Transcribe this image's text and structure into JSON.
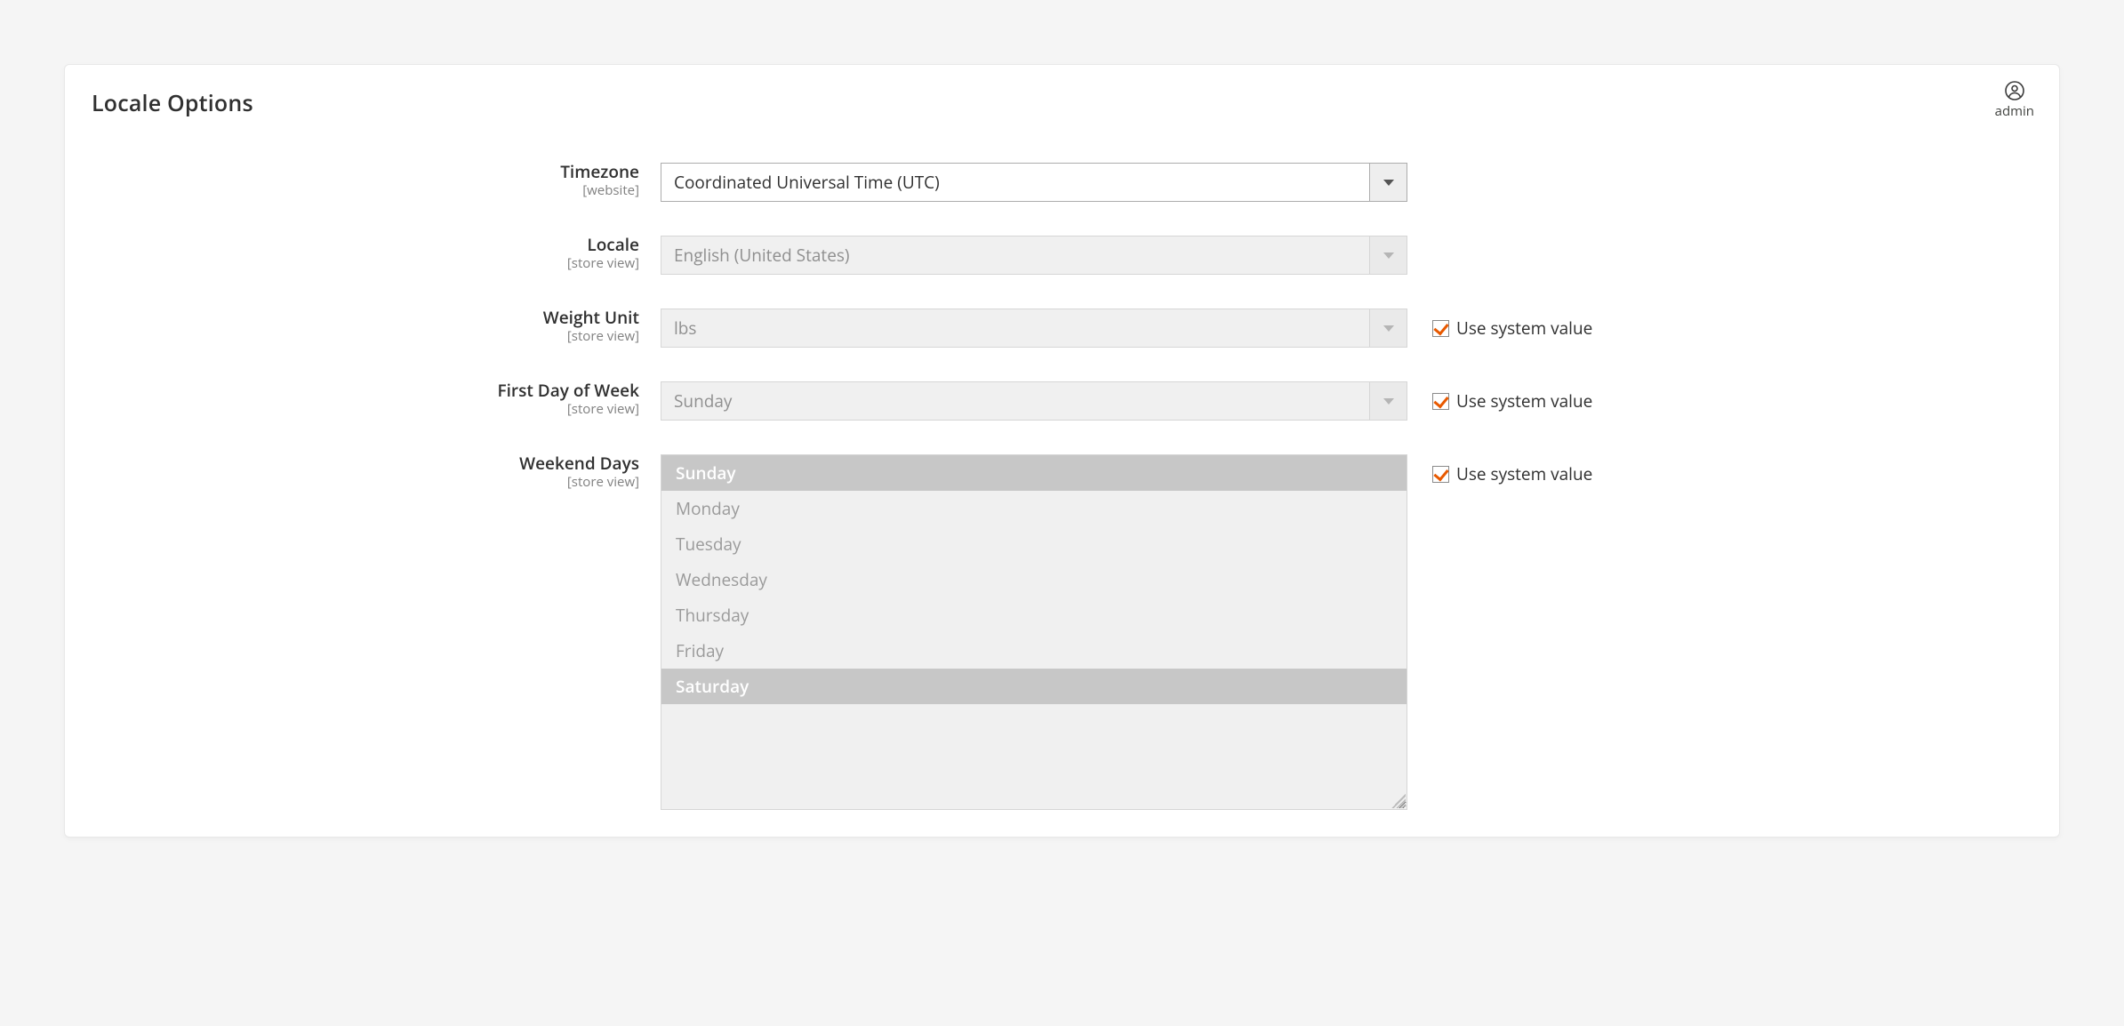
{
  "section": {
    "title": "Locale Options"
  },
  "header": {
    "admin_label": "admin"
  },
  "common": {
    "use_system_value": "Use system value"
  },
  "scopes": {
    "website": "[website]",
    "store_view": "[store view]"
  },
  "fields": {
    "timezone": {
      "label": "Timezone",
      "scope": "[website]",
      "value": "Coordinated Universal Time (UTC)"
    },
    "locale": {
      "label": "Locale",
      "scope": "[store view]",
      "value": "English (United States)"
    },
    "weight_unit": {
      "label": "Weight Unit",
      "scope": "[store view]",
      "value": "lbs",
      "use_system": true
    },
    "first_day_of_week": {
      "label": "First Day of Week",
      "scope": "[store view]",
      "value": "Sunday",
      "use_system": true
    },
    "weekend_days": {
      "label": "Weekend Days",
      "scope": "[store view]",
      "use_system": true,
      "options": [
        {
          "label": "Sunday",
          "selected": true
        },
        {
          "label": "Monday",
          "selected": false
        },
        {
          "label": "Tuesday",
          "selected": false
        },
        {
          "label": "Wednesday",
          "selected": false
        },
        {
          "label": "Thursday",
          "selected": false
        },
        {
          "label": "Friday",
          "selected": false
        },
        {
          "label": "Saturday",
          "selected": true
        }
      ]
    }
  }
}
